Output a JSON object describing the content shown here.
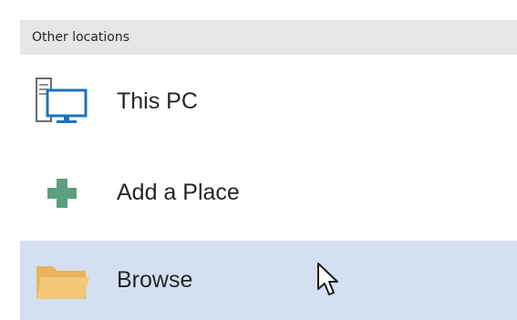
{
  "section": {
    "title": "Other locations"
  },
  "items": [
    {
      "label": "This PC",
      "icon": "computer-icon"
    },
    {
      "label": "Add a Place",
      "icon": "plus-icon"
    },
    {
      "label": "Browse",
      "icon": "folder-icon",
      "selected": true
    }
  ],
  "colors": {
    "header_bg": "#e6e6e6",
    "selected_bg": "#d4e0f1",
    "text": "#262626",
    "plus_green": "#5d9f7f",
    "monitor_blue": "#1e73be",
    "folder_yellow": "#f4c87a"
  }
}
